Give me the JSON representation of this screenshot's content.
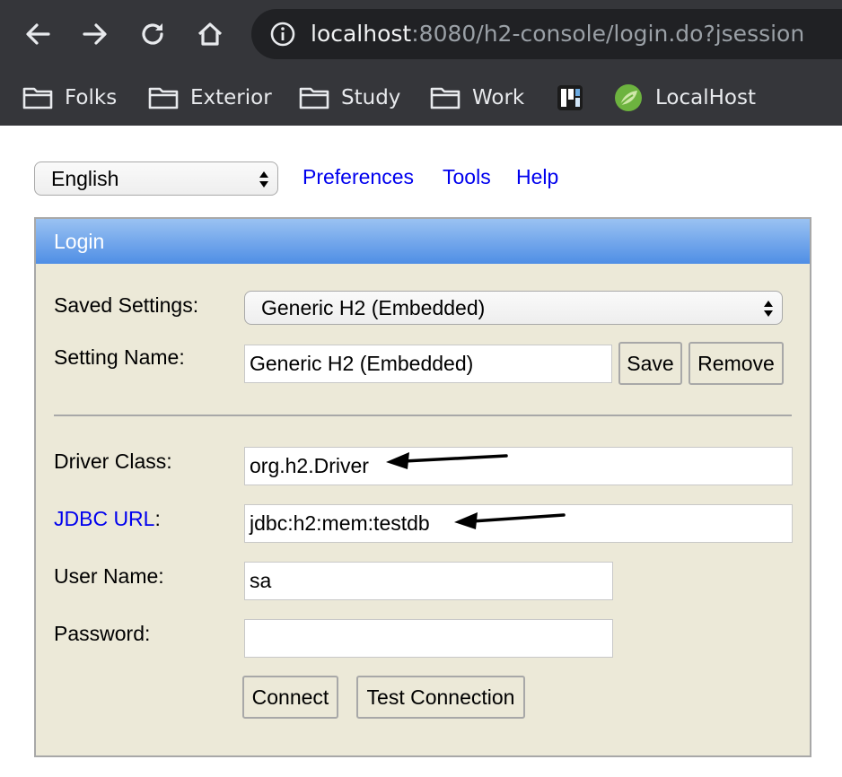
{
  "browser": {
    "url_host": "localhost",
    "url_rest": ":8080/h2-console/login.do?jsession",
    "nav_icons": [
      "back-icon",
      "forward-icon",
      "reload-icon",
      "home-icon"
    ],
    "bookmarks": [
      {
        "label": "Folks",
        "icon": "folder-icon"
      },
      {
        "label": "Exterior",
        "icon": "folder-icon"
      },
      {
        "label": "Study",
        "icon": "folder-icon"
      },
      {
        "label": "Work",
        "icon": "folder-icon"
      },
      {
        "label": "",
        "icon": "app-icon"
      },
      {
        "label": "LocalHost",
        "icon": "leaf-icon"
      }
    ]
  },
  "top": {
    "language": "English",
    "links": [
      "Preferences",
      "Tools",
      "Help"
    ]
  },
  "login": {
    "title": "Login",
    "saved_settings_label": "Saved Settings:",
    "saved_settings_value": "Generic H2 (Embedded)",
    "setting_name_label": "Setting Name:",
    "setting_name_value": "Generic H2 (Embedded)",
    "save_label": "Save",
    "remove_label": "Remove",
    "driver_class_label": "Driver Class:",
    "driver_class_value": "org.h2.Driver",
    "jdbc_url_link": "JDBC URL",
    "jdbc_url_colon": ":",
    "jdbc_url_value": "jdbc:h2:mem:testdb",
    "user_name_label": "User Name:",
    "user_name_value": "sa",
    "password_label": "Password:",
    "password_value": "",
    "connect_label": "Connect",
    "test_connection_label": "Test Connection"
  },
  "colors": {
    "chrome_bg": "#35363a",
    "panel_bg": "#ece9d8",
    "header_top": "#9ac2f2",
    "header_bottom": "#4f8ee5",
    "link": "#0000ee"
  }
}
